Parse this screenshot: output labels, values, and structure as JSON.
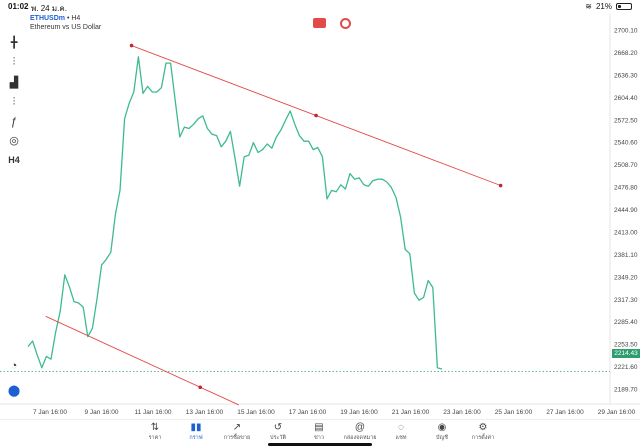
{
  "status_bar": {
    "time": "01:02",
    "date": "พ. 24 ม.ค.",
    "battery": "21%",
    "battery_level": 0.21
  },
  "symbol": {
    "name": "ETHUSDm",
    "timeframe": "H4",
    "description": "Ethereum vs US Dollar"
  },
  "toolbar": {
    "items": [
      {
        "name": "crosshair-icon",
        "glyph": "╋"
      },
      {
        "name": "indicators-icon",
        "glyph": "⫶"
      },
      {
        "name": "bars-icon",
        "glyph": "▟"
      },
      {
        "name": "chart-type-icon",
        "glyph": "⫶"
      },
      {
        "name": "function-icon",
        "glyph": "ƒ"
      },
      {
        "name": "shapes-icon",
        "glyph": "◎"
      },
      {
        "name": "timeframe-label",
        "glyph": "H4"
      }
    ]
  },
  "colors": {
    "line": "#3dbb8f",
    "trend": "#e34a4a",
    "current": "#2f9e6f",
    "accent": "#1e5fd3"
  },
  "chart_data": {
    "type": "line",
    "title": "ETHUSDm",
    "current_price": "2214.43",
    "y_ticks": [
      "2700.10",
      "2668.20",
      "2636.30",
      "2604.40",
      "2572.50",
      "2540.60",
      "2508.70",
      "2476.80",
      "2444.90",
      "2413.00",
      "2381.10",
      "2349.20",
      "2317.30",
      "2285.40",
      "2253.50",
      "2221.60",
      "2189.70"
    ],
    "x_ticks": [
      "7 Jan 16:00",
      "9 Jan 16:00",
      "11 Jan 16:00",
      "13 Jan 16:00",
      "15 Jan 16:00",
      "17 Jan 16:00",
      "19 Jan 16:00",
      "21 Jan 16:00",
      "23 Jan 16:00",
      "25 Jan 16:00",
      "27 Jan 16:00",
      "29 Jan 16:00"
    ],
    "series": [
      {
        "values": [
          2250,
          2258,
          2238,
          2220,
          2236,
          2232,
          2270,
          2300,
          2352,
          2335,
          2314,
          2312,
          2306,
          2264,
          2276,
          2318,
          2366,
          2374,
          2384,
          2438,
          2472,
          2574,
          2596,
          2612,
          2662,
          2610,
          2620,
          2612,
          2612,
          2618,
          2653,
          2653,
          2600,
          2548,
          2562,
          2560,
          2566,
          2574,
          2578,
          2560,
          2552,
          2550,
          2534,
          2542,
          2556,
          2518,
          2478,
          2520,
          2522,
          2540,
          2526,
          2530,
          2538,
          2532,
          2548,
          2558,
          2572,
          2585,
          2566,
          2550,
          2542,
          2542,
          2530,
          2533,
          2520,
          2460,
          2472,
          2470,
          2480,
          2474,
          2496,
          2488,
          2490,
          2480,
          2478,
          2486,
          2488,
          2488,
          2484,
          2476,
          2462,
          2434,
          2388,
          2382,
          2326,
          2316,
          2320,
          2344,
          2334,
          2220,
          2218
        ]
      }
    ],
    "trendlines": [
      {
        "from": [
          "10 Jan 20:00",
          2678
        ],
        "to": [
          "25 Jan 04:00",
          2479
        ]
      },
      {
        "from": [
          "7 Jan 12:00",
          2293
        ],
        "to": [
          "15 Jan 00:00",
          2167
        ]
      }
    ]
  },
  "tabs": [
    {
      "label": "ราคา",
      "glyph": "⇅",
      "name": "tab-quotes"
    },
    {
      "label": "กราฟ",
      "glyph": "▮▮",
      "name": "tab-chart",
      "active": true
    },
    {
      "label": "การซื้อขาย",
      "glyph": "↗",
      "name": "tab-trade"
    },
    {
      "label": "ประวัติ",
      "glyph": "↺",
      "name": "tab-history"
    },
    {
      "label": "ข่าว",
      "glyph": "▤",
      "name": "tab-news"
    },
    {
      "label": "กล่องจดหมาย",
      "glyph": "@",
      "name": "tab-mailbox"
    },
    {
      "label": "แชท",
      "glyph": "◌",
      "name": "tab-chat"
    },
    {
      "label": "บัญชี",
      "glyph": "◉",
      "name": "tab-account"
    },
    {
      "label": "การตั้งค่า",
      "glyph": "⚙",
      "name": "tab-settings"
    }
  ]
}
